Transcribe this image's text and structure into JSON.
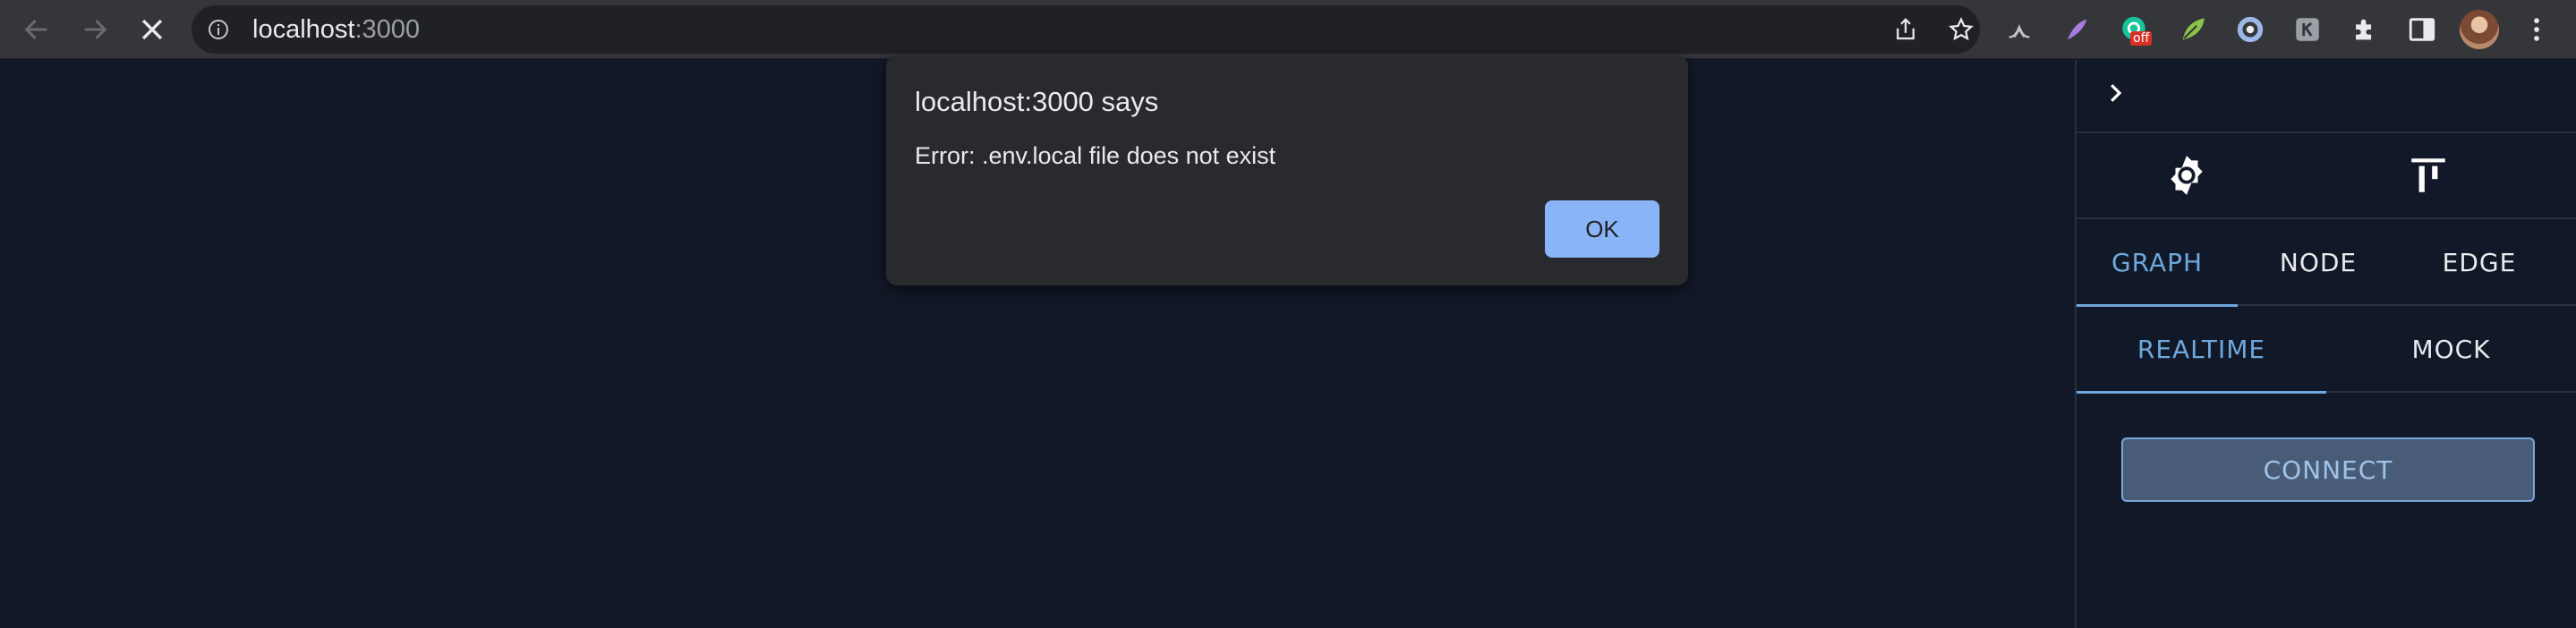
{
  "browser": {
    "url_host": "localhost",
    "url_port": ":3000",
    "extensions": [
      "ext-leaf-icon",
      "ext-feather-icon",
      "ext-grammarly-icon",
      "ext-leaf-green-icon",
      "ext-ring-icon",
      "ext-k-icon",
      "extensions-puzzle-icon",
      "sidebar-icon"
    ],
    "badge_text": "off"
  },
  "dialog": {
    "title": "localhost:3000 says",
    "message": "Error: .env.local file does not exist",
    "ok_label": "OK"
  },
  "panel": {
    "main_tabs": [
      {
        "label": "GRAPH",
        "active": true
      },
      {
        "label": "NODE",
        "active": false
      },
      {
        "label": "EDGE",
        "active": false
      }
    ],
    "mode_tabs": [
      {
        "label": "REALTIME",
        "active": true
      },
      {
        "label": "MOCK",
        "active": false
      }
    ],
    "connect_label": "CONNECT"
  },
  "colors": {
    "page_bg": "#121827",
    "accent": "#6fa8dc",
    "dialog_bg": "#292a2d",
    "ok_button": "#8ab4f8"
  }
}
